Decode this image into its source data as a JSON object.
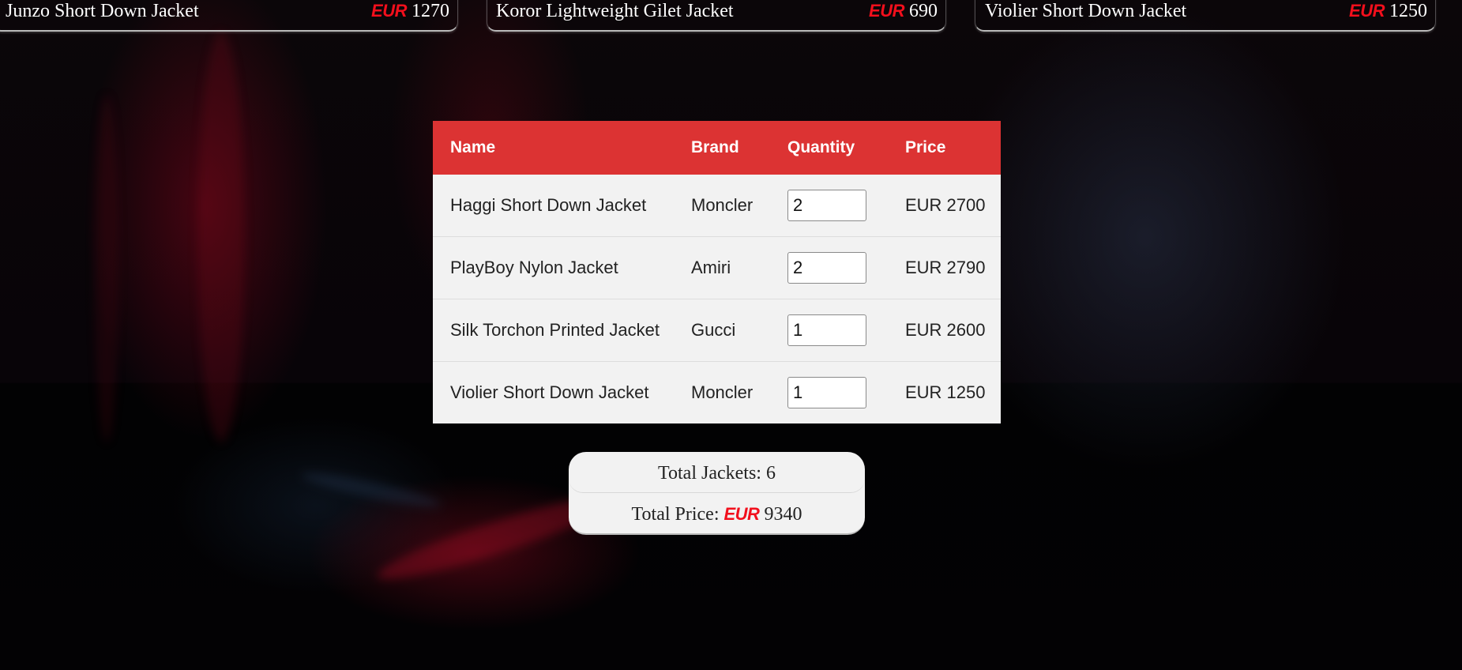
{
  "colors": {
    "accent_red": "#dc3333",
    "currency_red": "#f20f1c",
    "panel_bg": "#f2f2f2",
    "text_dark": "#222222"
  },
  "products": [
    {
      "name": "Junzo Short Down Jacket",
      "currency": "EUR",
      "price": "1270"
    },
    {
      "name": "Koror Lightweight Gilet Jacket",
      "currency": "EUR",
      "price": "690"
    },
    {
      "name": "Violier Short Down Jacket",
      "currency": "EUR",
      "price": "1250"
    }
  ],
  "cart": {
    "headers": {
      "name": "Name",
      "brand": "Brand",
      "quantity": "Quantity",
      "price": "Price"
    },
    "rows": [
      {
        "name": "Haggi Short Down Jacket",
        "brand": "Moncler",
        "quantity": "2",
        "price": "EUR 2700"
      },
      {
        "name": "PlayBoy Nylon Jacket",
        "brand": "Amiri",
        "quantity": "2",
        "price": "EUR 2790"
      },
      {
        "name": "Silk Torchon Printed Jacket",
        "brand": "Gucci",
        "quantity": "1",
        "price": "EUR 2600"
      },
      {
        "name": "Violier Short Down Jacket",
        "brand": "Moncler",
        "quantity": "1",
        "price": "EUR 1250"
      }
    ]
  },
  "totals": {
    "jackets_label": "Total Jackets:",
    "jackets_value": "6",
    "price_label": "Total Price:",
    "price_currency": "EUR",
    "price_value": "9340"
  }
}
